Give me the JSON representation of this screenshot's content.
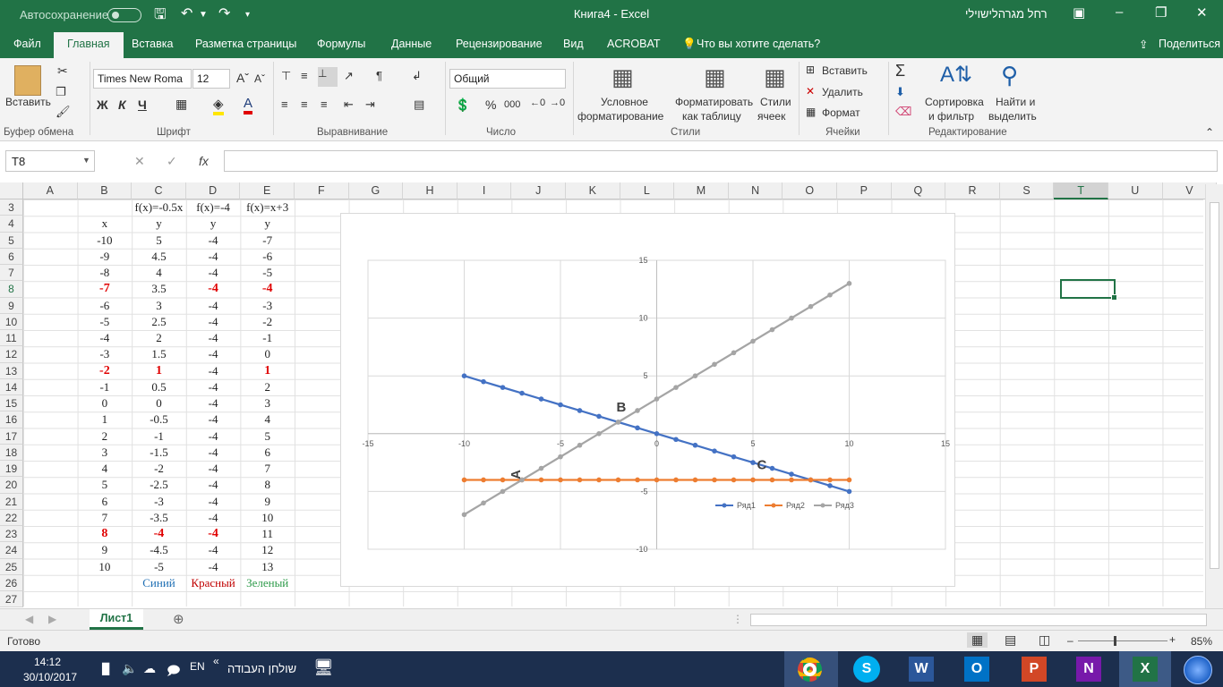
{
  "titlebar": {
    "autosave": "Автосохранение",
    "doc_title": "Книга4  -  Excel",
    "user": "רחל מגרהלישוילי"
  },
  "tabs": [
    "Файл",
    "Главная",
    "Вставка",
    "Разметка страницы",
    "Формулы",
    "Данные",
    "Рецензирование",
    "Вид",
    "ACROBAT",
    "Что вы хотите сделать?",
    "Поделиться"
  ],
  "ribbon": {
    "clipboard": {
      "paste": "Вставить",
      "label": "Буфер обмена"
    },
    "font": {
      "name": "Times New Roma",
      "size": "12",
      "bold": "Ж",
      "italic": "К",
      "underline": "Ч",
      "label": "Шрифт"
    },
    "alignment": {
      "label": "Выравнивание"
    },
    "number": {
      "format": "Общий",
      "percent": "%",
      "thousands": "000",
      "label": "Число"
    },
    "styles": {
      "conditional": "Условное",
      "conditional2": "форматирование",
      "astable": "Форматировать",
      "astable2": "как таблицу",
      "cellstyles": "Стили",
      "cellstyles2": "ячеек",
      "label": "Стили"
    },
    "cells": {
      "insert": "Вставить",
      "delete": "Удалить",
      "format": "Формат",
      "label": "Ячейки"
    },
    "editing": {
      "sort": "Сортировка",
      "sort2": "и фильтр",
      "find": "Найти и",
      "find2": "выделить",
      "label": "Редактирование"
    }
  },
  "formula_bar": {
    "name_box": "T8",
    "fx": "fx",
    "value": ""
  },
  "columns": [
    "A",
    "B",
    "C",
    "D",
    "E",
    "F",
    "G",
    "H",
    "I",
    "J",
    "K",
    "L",
    "M",
    "N",
    "O",
    "P",
    "Q",
    "R",
    "S",
    "T",
    "U",
    "V"
  ],
  "selected_column": "T",
  "row_numbers": [
    "3",
    "4",
    "5",
    "6",
    "7",
    "8",
    "9",
    "10",
    "11",
    "12",
    "13",
    "14",
    "15",
    "16",
    "17",
    "18",
    "19",
    "20",
    "21",
    "22",
    "23",
    "24",
    "25",
    "26",
    "27"
  ],
  "selected_row": "8",
  "table": {
    "headers": [
      "f(x)=-0.5x",
      "f(x)=-4",
      "f(x)=x+3"
    ],
    "subheaders": [
      "x",
      "y",
      "y",
      "y"
    ],
    "rows": [
      [
        "-10",
        "5",
        "-4",
        "-7"
      ],
      [
        "-9",
        "4.5",
        "-4",
        "-6"
      ],
      [
        "-8",
        "4",
        "-4",
        "-5"
      ],
      [
        "-7",
        "3.5",
        "-4",
        "-4"
      ],
      [
        "-6",
        "3",
        "-4",
        "-3"
      ],
      [
        "-5",
        "2.5",
        "-4",
        "-2"
      ],
      [
        "-4",
        "2",
        "-4",
        "-1"
      ],
      [
        "-3",
        "1.5",
        "-4",
        "0"
      ],
      [
        "-2",
        "1",
        "-4",
        "1"
      ],
      [
        "-1",
        "0.5",
        "-4",
        "2"
      ],
      [
        "0",
        "0",
        "-4",
        "3"
      ],
      [
        "1",
        "-0.5",
        "-4",
        "4"
      ],
      [
        "2",
        "-1",
        "-4",
        "5"
      ],
      [
        "3",
        "-1.5",
        "-4",
        "6"
      ],
      [
        "4",
        "-2",
        "-4",
        "7"
      ],
      [
        "5",
        "-2.5",
        "-4",
        "8"
      ],
      [
        "6",
        "-3",
        "-4",
        "9"
      ],
      [
        "7",
        "-3.5",
        "-4",
        "10"
      ],
      [
        "8",
        "-4",
        "-4",
        "11"
      ],
      [
        "9",
        "-4.5",
        "-4",
        "12"
      ],
      [
        "10",
        "-5",
        "-4",
        "13"
      ]
    ],
    "highlight_rows": [
      3,
      8,
      18
    ],
    "footer": [
      "Синий",
      "Красный",
      "Зеленый"
    ],
    "footer_colors": [
      "#1f6fb4",
      "#c00000",
      "#2e9b4a"
    ]
  },
  "chart_data": {
    "type": "scatter",
    "x": [
      -10,
      -9,
      -8,
      -7,
      -6,
      -5,
      -4,
      -3,
      -2,
      -1,
      0,
      1,
      2,
      3,
      4,
      5,
      6,
      7,
      8,
      9,
      10
    ],
    "series": [
      {
        "name": "Ряд1",
        "color": "#4472c4",
        "values": [
          5,
          4.5,
          4,
          3.5,
          3,
          2.5,
          2,
          1.5,
          1,
          0.5,
          0,
          -0.5,
          -1,
          -1.5,
          -2,
          -2.5,
          -3,
          -3.5,
          -4,
          -4.5,
          -5
        ]
      },
      {
        "name": "Ряд2",
        "color": "#ed7d31",
        "values": [
          -4,
          -4,
          -4,
          -4,
          -4,
          -4,
          -4,
          -4,
          -4,
          -4,
          -4,
          -4,
          -4,
          -4,
          -4,
          -4,
          -4,
          -4,
          -4,
          -4,
          -4
        ]
      },
      {
        "name": "Ряд3",
        "color": "#a5a5a5",
        "values": [
          -7,
          -6,
          -5,
          -4,
          -3,
          -2,
          -1,
          0,
          1,
          2,
          3,
          4,
          5,
          6,
          7,
          8,
          9,
          10,
          11,
          12,
          13
        ]
      }
    ],
    "xlim": [
      -15,
      15
    ],
    "ylim": [
      -10,
      15
    ],
    "xticks": [
      "-15",
      "-10",
      "-5",
      "0",
      "5",
      "10",
      "15"
    ],
    "yticks": [
      "15",
      "10",
      "5",
      "-5",
      "-10"
    ],
    "annotations": [
      {
        "text": "A",
        "x": -7,
        "y": -4
      },
      {
        "text": "B",
        "x": -2,
        "y": 1
      },
      {
        "text": "C",
        "x": 8,
        "y": -4
      }
    ],
    "grid": true,
    "legend": "bottom-right"
  },
  "sheet": {
    "tab": "Лист1"
  },
  "status": {
    "ready": "Готово",
    "zoom": "85%"
  },
  "taskbar": {
    "time": "14:12",
    "date": "30/10/2017",
    "lang": "EN",
    "desktop": "שולחן העבודה"
  }
}
